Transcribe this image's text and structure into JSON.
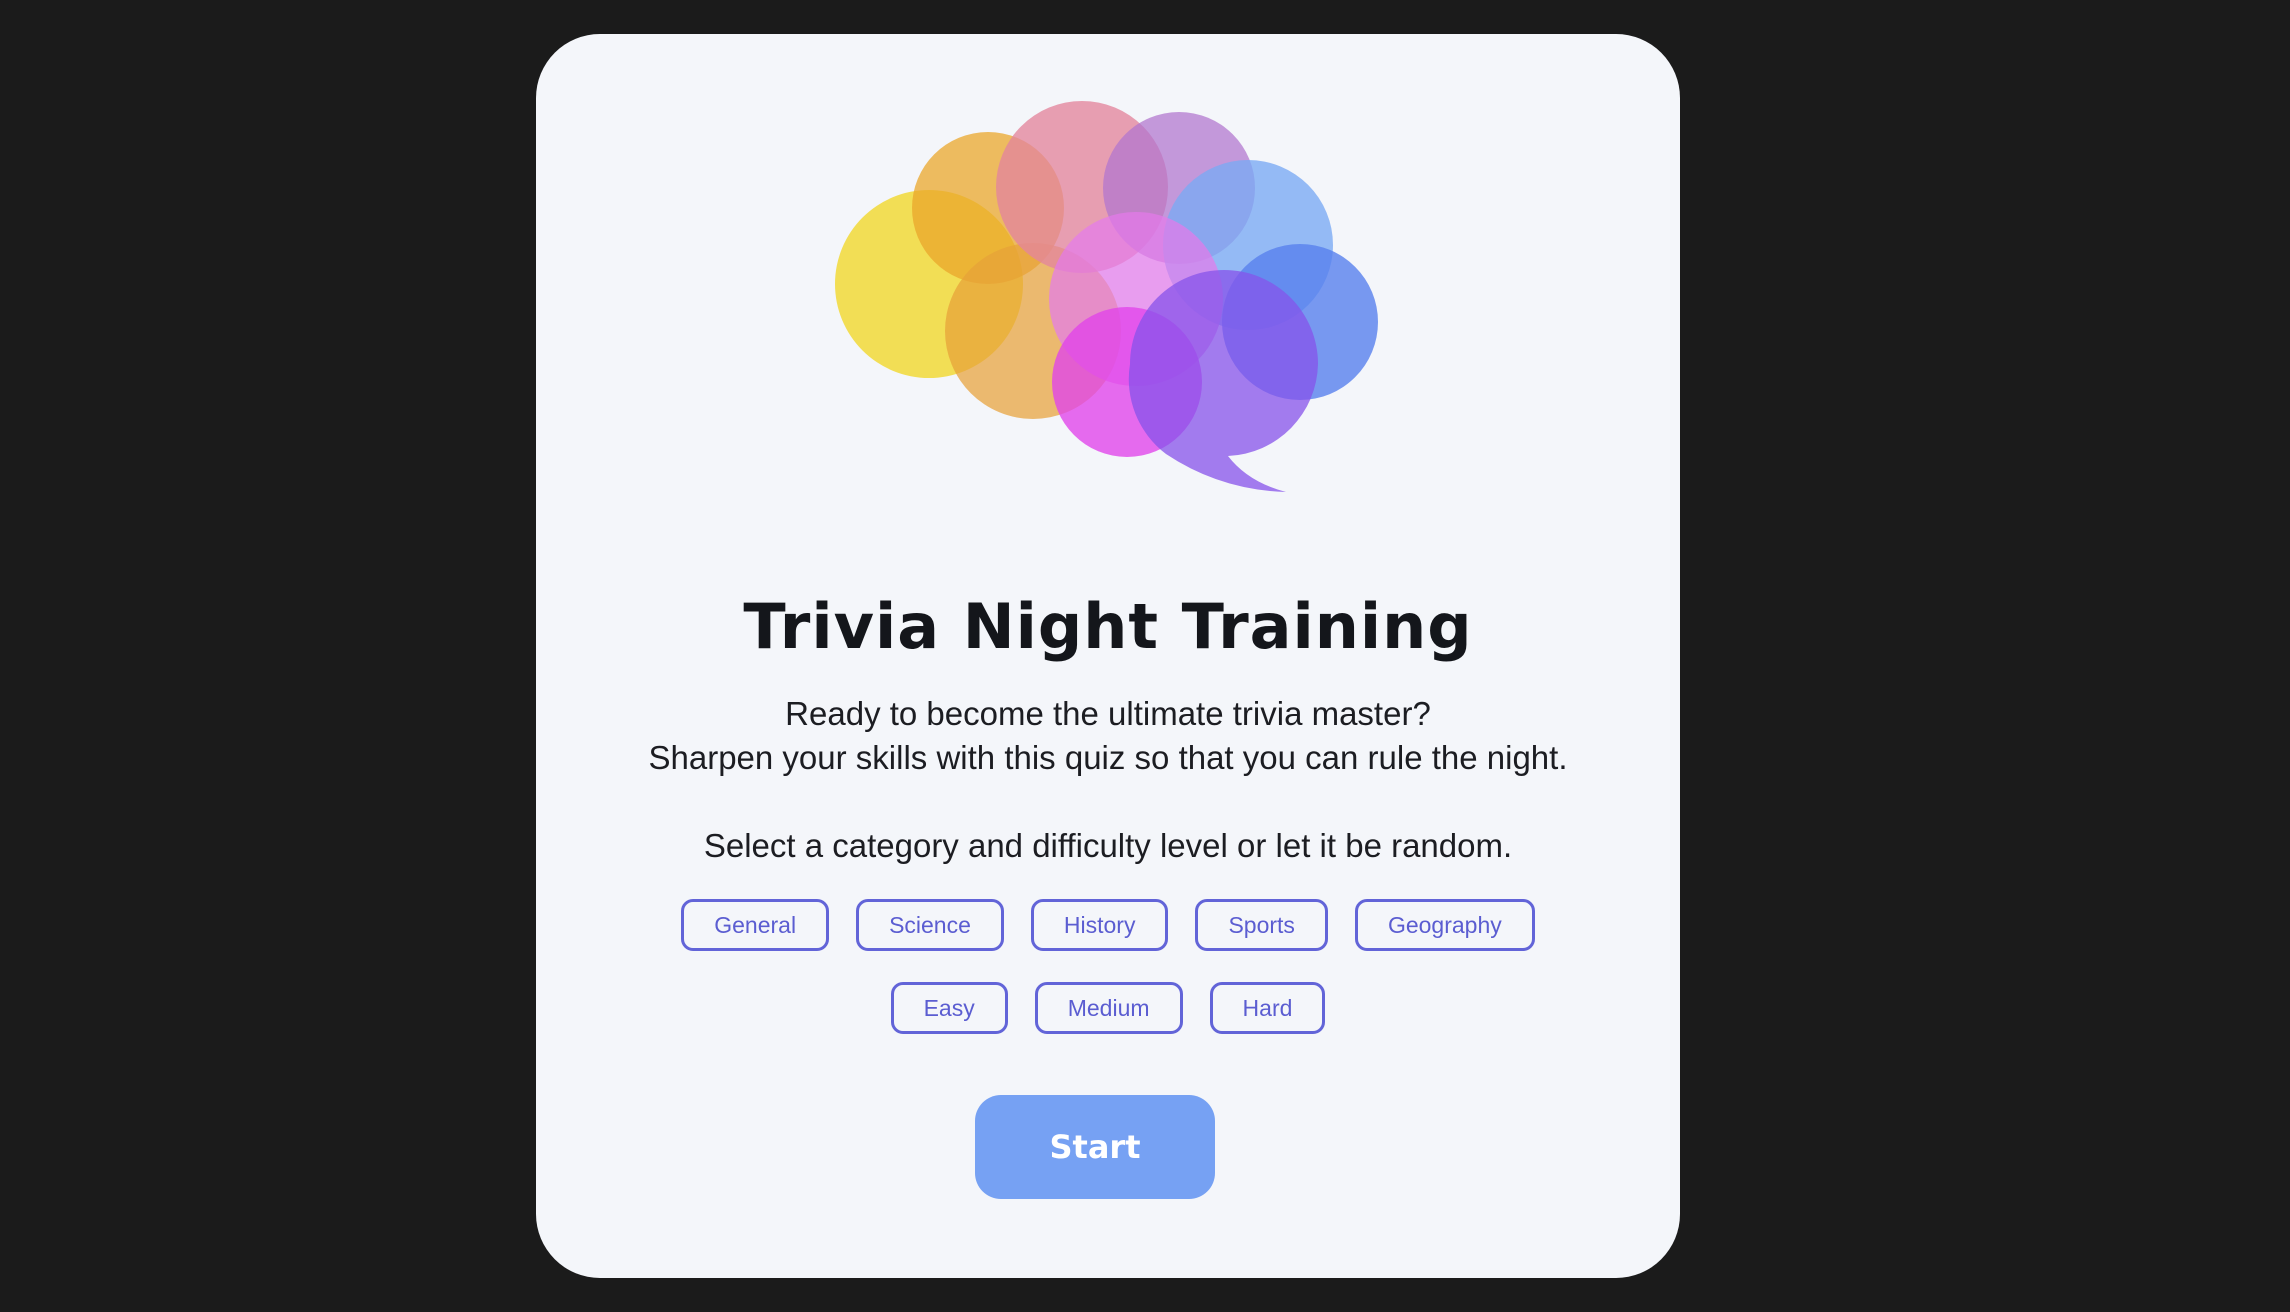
{
  "app": {
    "title": "Trivia Night Training",
    "description_line1": "Ready to become the ultimate trivia master?",
    "description_line2": "Sharpen your skills with this quiz so that you can rule the night.",
    "instruction": "Select a category and difficulty level or let it be random."
  },
  "categories": [
    "General",
    "Science",
    "History",
    "Sports",
    "Geography"
  ],
  "difficulties": [
    "Easy",
    "Medium",
    "Hard"
  ],
  "start_label": "Start",
  "logo": {
    "icon": "brain-bubbles-icon",
    "colors": [
      "#fde23a",
      "#f7b43a",
      "#ee8aa0",
      "#c08ad6",
      "#8ab9f8",
      "#f2a5eb",
      "#ef45f0",
      "#5e7ff1",
      "#9a63f0"
    ]
  },
  "colors": {
    "background": "#1b1b1b",
    "card": "#f4f6fa",
    "accent": "#6264d8",
    "start_button": "#76a1f3",
    "text": "#14161b"
  }
}
